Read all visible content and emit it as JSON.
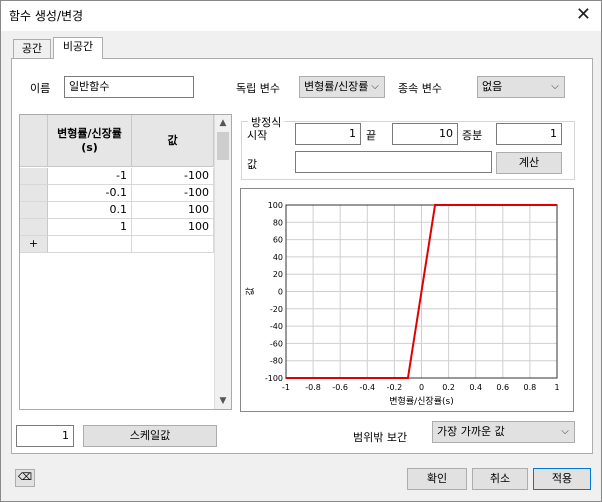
{
  "window": {
    "title": "함수 생성/변경",
    "close_icon": "close-icon"
  },
  "tabs": [
    {
      "label": "공간",
      "active": false
    },
    {
      "label": "비공간",
      "active": true
    }
  ],
  "name": {
    "label": "이름",
    "value": "일반함수"
  },
  "independent": {
    "label": "독립 변수",
    "value": "변형률/신장률"
  },
  "dependent": {
    "label": "종속 변수",
    "value": "없음"
  },
  "table": {
    "col_x": "변형률/신장률\n(s)",
    "col_y": "값",
    "rows": [
      {
        "x": "-1",
        "y": "-100"
      },
      {
        "x": "-0.1",
        "y": "-100"
      },
      {
        "x": "0.1",
        "y": "100"
      },
      {
        "x": "1",
        "y": "100"
      }
    ],
    "new_row_marker": "+"
  },
  "equation": {
    "legend": "방정식",
    "start_label": "시작",
    "start_value": "1",
    "end_label": "끝",
    "end_value": "10",
    "step_label": "증분",
    "step_value": "1",
    "value_label": "값",
    "value_value": "",
    "calc_button": "계산"
  },
  "scale": {
    "value": "1",
    "button": "스케일값"
  },
  "extrapolation": {
    "label": "범위밖 보간",
    "value": "가장 가까운 값"
  },
  "footer": {
    "ok": "확인",
    "cancel": "취소",
    "apply": "적용",
    "eraser_icon": "eraser-icon"
  },
  "chart_data": {
    "type": "line",
    "xlabel": "변형률/신장률(s)",
    "ylabel": "값",
    "xlim": [
      -1,
      1
    ],
    "ylim": [
      -100,
      100
    ],
    "x_ticks": [
      "-1",
      "-0.8",
      "-0.6",
      "-0.4",
      "-0.2",
      "0",
      "0.2",
      "0.4",
      "0.6",
      "0.8",
      "1"
    ],
    "y_ticks": [
      "100",
      "80",
      "60",
      "40",
      "20",
      "0",
      "-20",
      "-40",
      "-60",
      "-80",
      "-100"
    ],
    "grid": true,
    "series": [
      {
        "color": "#e00000",
        "points": [
          [
            -1,
            -100
          ],
          [
            -0.1,
            -100
          ],
          [
            0.1,
            100
          ],
          [
            1,
            100
          ]
        ]
      }
    ]
  }
}
